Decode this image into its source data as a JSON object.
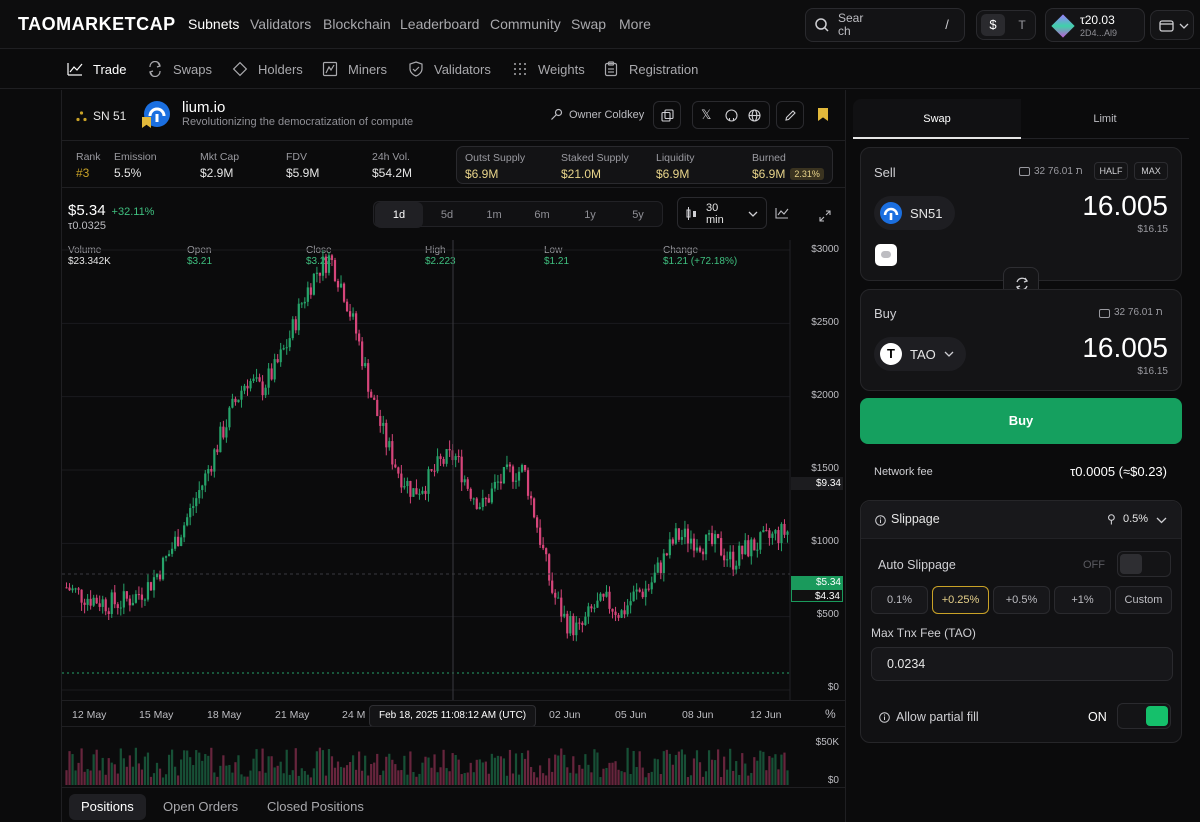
{
  "brand": {
    "logo": "TAOMARKETCAP"
  },
  "topnav": {
    "items": [
      {
        "label": "Subnets",
        "active": true
      },
      {
        "label": "Validators"
      },
      {
        "label": "Blockchain"
      },
      {
        "label": "Leaderboard"
      },
      {
        "label": "Community"
      },
      {
        "label": "Swap"
      },
      {
        "label": "More"
      }
    ],
    "search_placeholder": "Search",
    "search_shortcut": "/",
    "currency_usd": "$",
    "currency_tao": "T",
    "wallet_balance": "τ20.03",
    "wallet_address": "2D4...Al9"
  },
  "subnav": {
    "tabs": [
      {
        "label": "Trade",
        "icon": "chart-line-icon",
        "active": true
      },
      {
        "label": "Swaps",
        "icon": "swap-arrows-icon"
      },
      {
        "label": "Holders",
        "icon": "diamond-icon"
      },
      {
        "label": "Miners",
        "icon": "miner-icon"
      },
      {
        "label": "Validators",
        "icon": "shield-check-icon"
      },
      {
        "label": "Weights",
        "icon": "dots-grid-icon"
      },
      {
        "label": "Registration",
        "icon": "clipboard-icon"
      }
    ]
  },
  "subnet": {
    "badge": "SN 51",
    "name": "lium.io",
    "tagline": "Revolutionizing the democratization of compute",
    "owner_label": "Owner Coldkey"
  },
  "stats": [
    {
      "label": "Rank",
      "value": "#3"
    },
    {
      "label": "Emission",
      "value": "5.5%"
    },
    {
      "label": "Mkt Cap",
      "value": "$2.9M"
    },
    {
      "label": "FDV",
      "value": "$5.9M"
    },
    {
      "label": "24h Vol.",
      "value": "$54.2M"
    }
  ],
  "supply_stats": [
    {
      "label": "Outst Supply",
      "value": "$6.9M"
    },
    {
      "label": "Staked Supply",
      "value": "$21.0M"
    },
    {
      "label": "Liquidity",
      "value": "$6.9M"
    },
    {
      "label": "Burned",
      "value": "$6.9M",
      "badge": "2.31%"
    }
  ],
  "price": {
    "usd": "$5.34",
    "change": "+32.11%",
    "tao": "τ0.0325"
  },
  "timeframes": [
    "1d",
    "5d",
    "1m",
    "6m",
    "1y",
    "5y"
  ],
  "active_timeframe": "1d",
  "interval": {
    "value": "30",
    "unit": "min"
  },
  "ohlc": [
    {
      "label": "Volume",
      "value": "$23.342K",
      "green": false
    },
    {
      "label": "Open",
      "value": "$3.21",
      "green": true
    },
    {
      "label": "Close",
      "value": "$3.22",
      "green": true
    },
    {
      "label": "High",
      "value": "$2.223",
      "green": true
    },
    {
      "label": "Low",
      "value": "$1.21",
      "green": true
    },
    {
      "label": "Change",
      "value": "$1.21 (+72.18%)",
      "green": true
    }
  ],
  "chart_data": {
    "type": "candlestick",
    "y_ticks": [
      "$3000",
      "$2500",
      "$2000",
      "$1500",
      "$1000",
      "$500",
      "$0"
    ],
    "ylim": [
      0,
      3000
    ],
    "x_ticks": [
      "12 May",
      "15 May",
      "18 May",
      "21 May",
      "24 M",
      "02 Jun",
      "05 Jun",
      "08 Jun",
      "12 Jun"
    ],
    "x_axis_extra": "%",
    "crosshair_label": "Feb 18, 2025 11:08:12 AM (UTC)",
    "crosshair_price": "$9.34",
    "current_price": "$5.34",
    "prev_price": "$4.34",
    "volume_ticks": [
      "$50K",
      "$0"
    ],
    "price_path": [
      700,
      650,
      620,
      590,
      600,
      640,
      720,
      860,
      1040,
      1230,
      1450,
      1700,
      1930,
      2120,
      2050,
      2180,
      2380,
      2650,
      2850,
      2950,
      2720,
      2400,
      2000,
      1700,
      1480,
      1350,
      1420,
      1550,
      1600,
      1380,
      1250,
      1400,
      1480,
      1500,
      1100,
      680,
      470,
      400,
      560,
      600,
      520,
      650,
      700,
      880,
      1050,
      1040,
      1000,
      980,
      880,
      960,
      1000,
      1050,
      1080
    ]
  },
  "bottom_tabs": [
    {
      "label": "Positions",
      "active": true
    },
    {
      "label": "Open Orders"
    },
    {
      "label": "Closed Positions"
    }
  ],
  "swap": {
    "mode_tabs": [
      {
        "label": "Swap",
        "active": true
      },
      {
        "label": "Limit"
      }
    ],
    "sell": {
      "title": "Sell",
      "balance": "ת 76.01 32",
      "half": "HALF",
      "max": "MAX",
      "token": "SN51",
      "amount": "16.005",
      "usd": "$16.15"
    },
    "buy": {
      "title": "Buy",
      "balance": "ת 76.01 32",
      "token": "TAO",
      "amount": "16.005",
      "usd": "$16.15"
    },
    "action_label": "Buy",
    "network_fee_label": "Network fee",
    "network_fee_value": "τ0.0005 (≈$0.23)",
    "slippage": {
      "title": "Slippage",
      "value": "0.5%",
      "auto_label": "Auto Slippage",
      "auto_state": "OFF",
      "options": [
        "0.1%",
        "+0.25%",
        "+0.5%",
        "+1%",
        "Custom"
      ],
      "selected_option": "+0.25%",
      "max_fee_label": "Max Tnx Fee (TAO)",
      "max_fee_value": "0.0234",
      "partial_fill_label": "Allow partial fill",
      "partial_fill_state": "ON"
    }
  },
  "colors": {
    "up": "#26a36a",
    "down": "#d6457a",
    "buy_button": "#15a05f",
    "accent_border": "#c9a227"
  }
}
